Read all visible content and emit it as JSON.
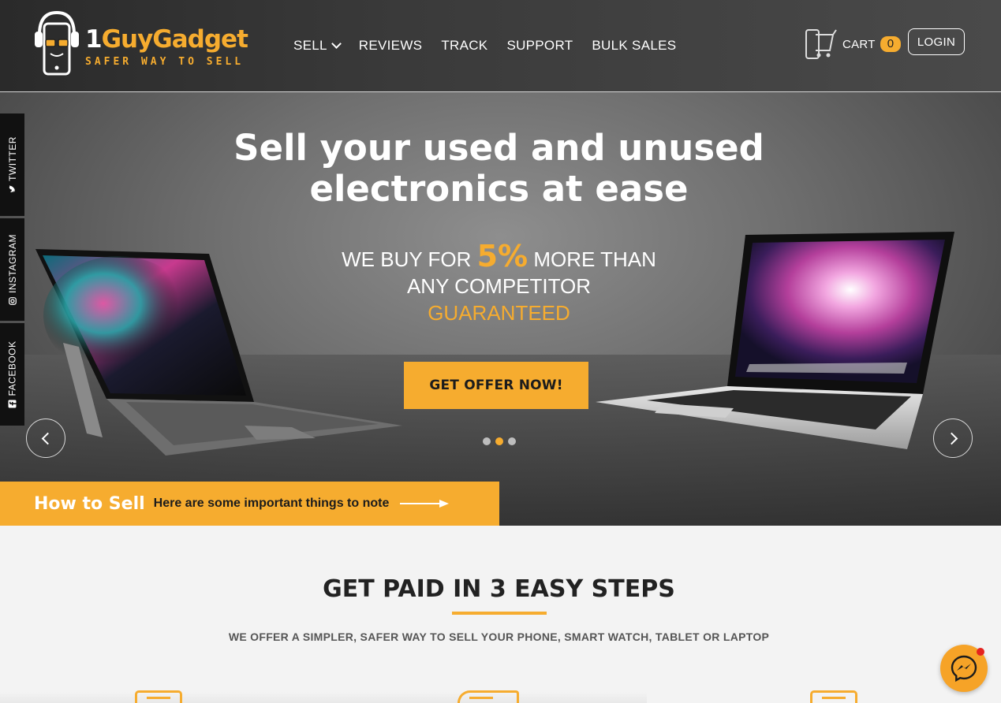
{
  "brand": {
    "name_prefix": "1",
    "name_main": "GuyGadget",
    "tagline": "SAFER WAY TO SELL",
    "accent_color": "#f6ac2f"
  },
  "nav": {
    "items": [
      {
        "label": "SELL",
        "has_dropdown": true
      },
      {
        "label": "REVIEWS"
      },
      {
        "label": "TRACK"
      },
      {
        "label": "SUPPORT"
      },
      {
        "label": "BULK SALES"
      }
    ]
  },
  "cart": {
    "label": "CART",
    "count": "0",
    "icon": "cart-icon"
  },
  "login": {
    "label": "LOGIN"
  },
  "social": {
    "twitter": "TWITTER",
    "instagram": "INSTAGRAM",
    "facebook": "FACEBOOK"
  },
  "hero": {
    "title_line1": "Sell your used and unused",
    "title_line2": "electronics at ease",
    "sub_pre": "WE BUY FOR ",
    "sub_pct": "5%",
    "sub_post": " MORE THAN",
    "sub_line2": "ANY COMPETITOR",
    "sub_line3": "GUARANTEED",
    "cta": "GET OFFER NOW!",
    "slides_total": 3,
    "active_slide": 2
  },
  "howto": {
    "title": "How to Sell",
    "note": "Here are some important things to note"
  },
  "steps": {
    "title": "GET PAID IN 3 EASY STEPS",
    "subtitle": "WE OFFER A SIMPLER, SAFER WAY TO SELL YOUR PHONE, SMART WATCH, TABLET OR LAPTOP"
  },
  "messenger": {
    "icon": "messenger-icon",
    "has_notification": true
  }
}
